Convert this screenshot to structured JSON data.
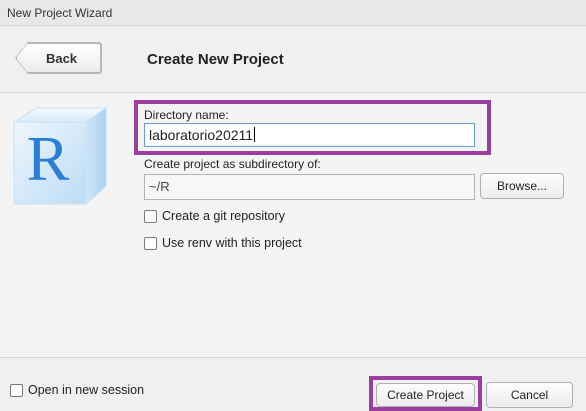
{
  "window": {
    "title": "New Project Wizard"
  },
  "header": {
    "back_label": "Back",
    "title": "Create New Project"
  },
  "form": {
    "directory_name_label": "Directory name:",
    "directory_name_value": "laboratorio20211",
    "subdirectory_label": "Create project as subdirectory of:",
    "subdirectory_value": "~/R",
    "browse_label": "Browse...",
    "git_label": "Create a git repository",
    "git_checked": false,
    "renv_label": "Use renv with this project",
    "renv_checked": false
  },
  "footer": {
    "new_session_label": "Open in new session",
    "new_session_checked": false,
    "create_label": "Create Project",
    "cancel_label": "Cancel"
  },
  "logo": {
    "icon": "r-logo-icon"
  },
  "colors": {
    "highlight": "#9b3f9e",
    "logo_blue": "#2a7fd4",
    "input_focus": "#6a9fd4"
  }
}
